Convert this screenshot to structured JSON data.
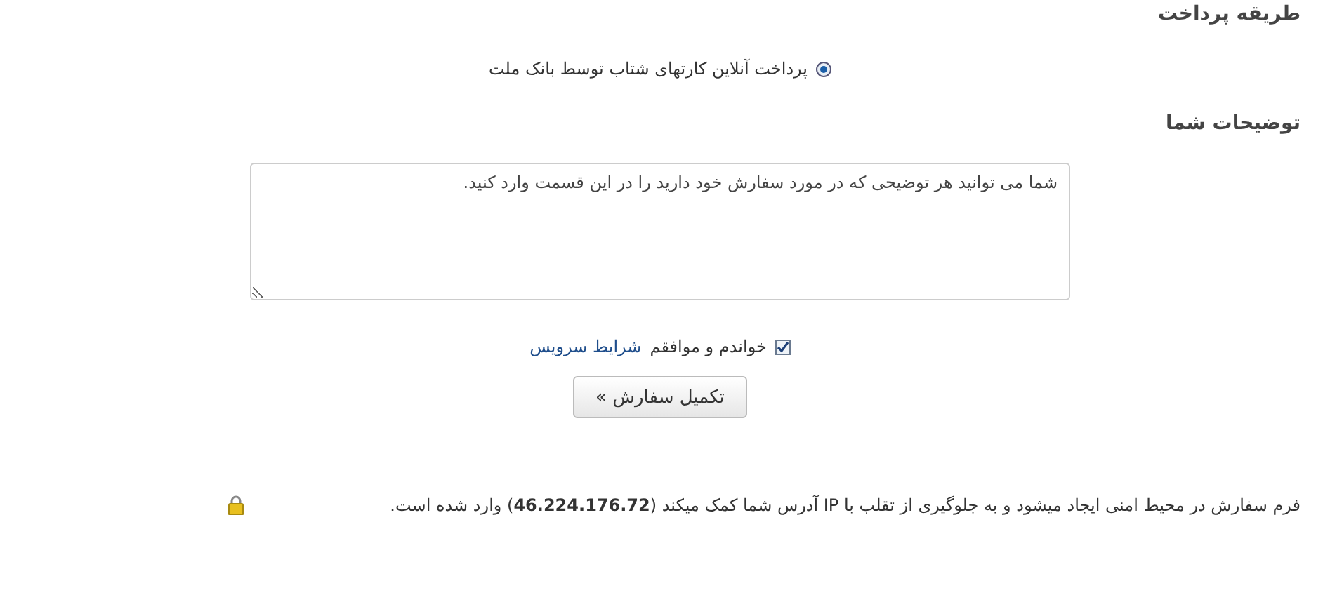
{
  "payment_section": {
    "heading": "طریقه پرداخت",
    "options": [
      {
        "label": "پرداخت آنلاین کارتهای شتاب توسط بانک ملت",
        "selected": true
      }
    ]
  },
  "notes_section": {
    "heading": "توضیحات شما",
    "textarea": {
      "value": "شما می توانید هر توضیحی که در مورد سفارش خود دارید را در این قسمت وارد کنید."
    }
  },
  "terms": {
    "checked": true,
    "label": "خواندم و موافقم",
    "link": "شرایط سرویس"
  },
  "submit_button": "تکمیل سفارش »",
  "security_notice": "فرم سفارش در محیط امنی ایجاد میشود و به جلوگیری از تقلب با IP آدرس شما کمک میکند (**46.224.176.72**) وارد شده است."
}
